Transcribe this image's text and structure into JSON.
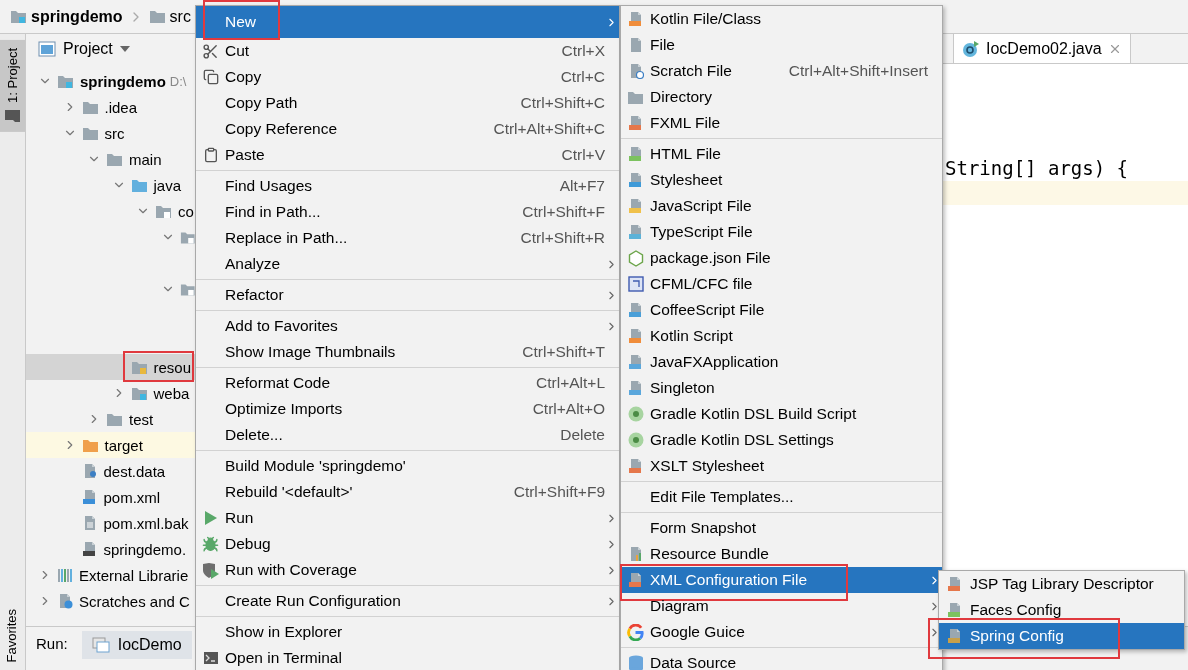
{
  "breadcrumb": [
    {
      "label": "springdemo",
      "kind": "module"
    },
    {
      "label": "src",
      "kind": "folder"
    }
  ],
  "tool_strip": {
    "top_tabs": [
      {
        "label": "1: Project",
        "selected": true
      }
    ],
    "bottom_tabs": [
      {
        "label": "Favorites",
        "selected": false
      }
    ]
  },
  "project_panel": {
    "title": "Project",
    "tree": [
      {
        "label": "springdemo",
        "path": "D:\\",
        "kind": "module",
        "expanded": true,
        "selected": false,
        "children": [
          {
            "label": ".idea",
            "kind": "folder",
            "expanded": false,
            "selected": false
          },
          {
            "label": "src",
            "kind": "folder",
            "expanded": true,
            "selected": false,
            "children": [
              {
                "label": "main",
                "kind": "folder",
                "expanded": true,
                "selected": false,
                "children": [
                  {
                    "label": "java",
                    "kind": "source-folder",
                    "expanded": true,
                    "selected": false,
                    "children": [
                      {
                        "label": "co",
                        "kind": "package",
                        "expanded": true,
                        "selected": false,
                        "children": [
                          {
                            "kind": "package",
                            "expanded": true,
                            "selected": false,
                            "children": [
                              {
                                "selected": false
                              }
                            ]
                          },
                          {
                            "kind": "package",
                            "expanded": true,
                            "selected": false,
                            "children": [
                              {
                                "selected": false
                              },
                              {
                                "selected": false
                              }
                            ]
                          }
                        ]
                      }
                    ]
                  },
                  {
                    "label": "resou",
                    "kind": "resources-folder",
                    "selected": true,
                    "annotated": true
                  },
                  {
                    "label": "weba",
                    "kind": "web-folder",
                    "expanded": false,
                    "selected": false
                  }
                ]
              },
              {
                "label": "test",
                "kind": "folder",
                "expanded": false,
                "selected": false
              }
            ]
          },
          {
            "label": "target",
            "kind": "excluded-folder",
            "expanded": false,
            "selected": false
          },
          {
            "label": "dest.data",
            "kind": "data-file",
            "selected": false
          },
          {
            "label": "pom.xml",
            "kind": "maven-file",
            "selected": false
          },
          {
            "label": "pom.xml.bak",
            "kind": "text-file",
            "selected": false
          },
          {
            "label": "springdemo.",
            "kind": "module-file",
            "selected": false
          }
        ]
      },
      {
        "label": "External Librarie",
        "kind": "libraries",
        "expanded": false,
        "selected": false
      },
      {
        "label": "Scratches and C",
        "kind": "scratches",
        "expanded": false,
        "selected": false
      }
    ]
  },
  "editor": {
    "tabs": [
      {
        "label": "IocDemo02.java",
        "selected": true
      }
    ],
    "code_lines": [
      "String[] args) {"
    ],
    "caret_line_highlighted": true
  },
  "run_panel": {
    "label": "Run:",
    "tabs": [
      {
        "label": "IocDemo",
        "selected": true
      }
    ]
  },
  "context_menu": {
    "groups": [
      {
        "items": [
          {
            "label": "New",
            "submenu": true,
            "selected": true,
            "annotated": true
          },
          {
            "label": "Cut",
            "shortcut": "Ctrl+X",
            "submenu": false,
            "selected": false
          },
          {
            "label": "Copy",
            "shortcut": "Ctrl+C",
            "submenu": false,
            "selected": false
          },
          {
            "label": "Copy Path",
            "shortcut": "Ctrl+Shift+C",
            "submenu": false,
            "selected": false
          },
          {
            "label": "Copy Reference",
            "shortcut": "Ctrl+Alt+Shift+C",
            "submenu": false,
            "selected": false
          },
          {
            "label": "Paste",
            "shortcut": "Ctrl+V",
            "submenu": false,
            "selected": false
          }
        ]
      },
      {
        "items": [
          {
            "label": "Find Usages",
            "shortcut": "Alt+F7",
            "submenu": false,
            "selected": false
          },
          {
            "label": "Find in Path...",
            "shortcut": "Ctrl+Shift+F",
            "submenu": false,
            "selected": false
          },
          {
            "label": "Replace in Path...",
            "shortcut": "Ctrl+Shift+R",
            "submenu": false,
            "selected": false
          },
          {
            "label": "Analyze",
            "submenu": true,
            "selected": false
          }
        ]
      },
      {
        "items": [
          {
            "label": "Refactor",
            "submenu": true,
            "selected": false
          }
        ]
      },
      {
        "items": [
          {
            "label": "Add to Favorites",
            "submenu": true,
            "selected": false
          },
          {
            "label": "Show Image Thumbnails",
            "shortcut": "Ctrl+Shift+T",
            "submenu": false,
            "selected": false
          }
        ]
      },
      {
        "items": [
          {
            "label": "Reformat Code",
            "shortcut": "Ctrl+Alt+L",
            "submenu": false,
            "selected": false
          },
          {
            "label": "Optimize Imports",
            "shortcut": "Ctrl+Alt+O",
            "submenu": false,
            "selected": false
          },
          {
            "label": "Delete...",
            "shortcut": "Delete",
            "submenu": false,
            "selected": false
          }
        ]
      },
      {
        "items": [
          {
            "label": "Build Module 'springdemo'",
            "submenu": false,
            "selected": false
          },
          {
            "label": "Rebuild '<default>'",
            "shortcut": "Ctrl+Shift+F9",
            "submenu": false,
            "selected": false
          },
          {
            "label": "Run",
            "submenu": true,
            "selected": false
          },
          {
            "label": "Debug",
            "submenu": true,
            "selected": false
          },
          {
            "label": "Run with Coverage",
            "submenu": true,
            "selected": false
          }
        ]
      },
      {
        "items": [
          {
            "label": "Create Run Configuration",
            "submenu": true,
            "selected": false
          }
        ]
      },
      {
        "items": [
          {
            "label": "Show in Explorer",
            "submenu": false,
            "selected": false
          },
          {
            "label": "Open in Terminal",
            "submenu": false,
            "selected": false
          }
        ]
      }
    ]
  },
  "new_submenu": {
    "groups": [
      {
        "items": [
          {
            "label": "Kotlin File/Class",
            "submenu": false,
            "selected": false
          },
          {
            "label": "File",
            "submenu": false,
            "selected": false
          },
          {
            "label": "Scratch File",
            "shortcut": "Ctrl+Alt+Shift+Insert",
            "submenu": false,
            "selected": false
          },
          {
            "label": "Directory",
            "submenu": false,
            "selected": false
          },
          {
            "label": "FXML File",
            "submenu": false,
            "selected": false
          }
        ]
      },
      {
        "items": [
          {
            "label": "HTML File",
            "submenu": false,
            "selected": false
          },
          {
            "label": "Stylesheet",
            "submenu": false,
            "selected": false
          },
          {
            "label": "JavaScript File",
            "submenu": false,
            "selected": false
          },
          {
            "label": "TypeScript File",
            "submenu": false,
            "selected": false
          },
          {
            "label": "package.json File",
            "submenu": false,
            "selected": false
          },
          {
            "label": "CFML/CFC file",
            "submenu": false,
            "selected": false
          },
          {
            "label": "CoffeeScript File",
            "submenu": false,
            "selected": false
          },
          {
            "label": "Kotlin Script",
            "submenu": false,
            "selected": false
          },
          {
            "label": "JavaFXApplication",
            "submenu": false,
            "selected": false
          },
          {
            "label": "Singleton",
            "submenu": false,
            "selected": false
          },
          {
            "label": "Gradle Kotlin DSL Build Script",
            "submenu": false,
            "selected": false
          },
          {
            "label": "Gradle Kotlin DSL Settings",
            "submenu": false,
            "selected": false
          },
          {
            "label": "XSLT Stylesheet",
            "submenu": false,
            "selected": false
          }
        ]
      },
      {
        "items": [
          {
            "label": "Edit File Templates...",
            "submenu": false,
            "selected": false
          }
        ]
      },
      {
        "items": [
          {
            "label": "Form Snapshot",
            "submenu": false,
            "selected": false
          },
          {
            "label": "Resource Bundle",
            "submenu": false,
            "selected": false
          },
          {
            "label": "XML Configuration File",
            "submenu": true,
            "selected": true,
            "annotated": true
          },
          {
            "label": "Diagram",
            "submenu": true,
            "selected": false
          },
          {
            "label": "Google Guice",
            "submenu": true,
            "selected": false
          }
        ]
      },
      {
        "items": [
          {
            "label": "Data Source",
            "submenu": false,
            "selected": false
          }
        ]
      }
    ]
  },
  "xml_submenu": {
    "groups": [
      {
        "items": [
          {
            "label": "JSP Tag Library Descriptor",
            "submenu": false,
            "selected": false
          },
          {
            "label": "Faces Config",
            "submenu": false,
            "selected": false
          },
          {
            "label": "Spring Config",
            "submenu": false,
            "selected": true,
            "annotated": true
          }
        ]
      }
    ]
  }
}
